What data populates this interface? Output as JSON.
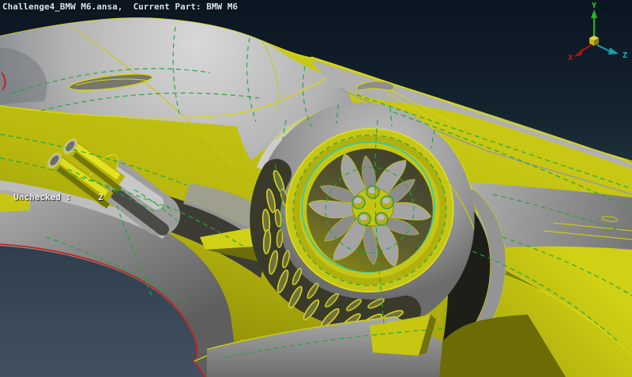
{
  "window": {
    "title": "Challenge4_BMW M6.ansa,  Current Part: BMW M6"
  },
  "status": {
    "unchecked_label": "Unchecked :",
    "unchecked_value": "2"
  },
  "axis_triad": {
    "x_label": "X",
    "y_label": "Y",
    "z_label": "Z"
  },
  "colors": {
    "background_top": "#0b1520",
    "background_bottom": "#41515f",
    "body_yellow": "#c6c614",
    "surface_gray": "#a8a8a8",
    "edge_red": "#c42222",
    "mesh_green": "#1fa63a",
    "rim_teal": "#35c9a0",
    "axis_x_red": "#c01818",
    "axis_y_green": "#2ad42a",
    "axis_z_cyan": "#1fb4c8"
  }
}
